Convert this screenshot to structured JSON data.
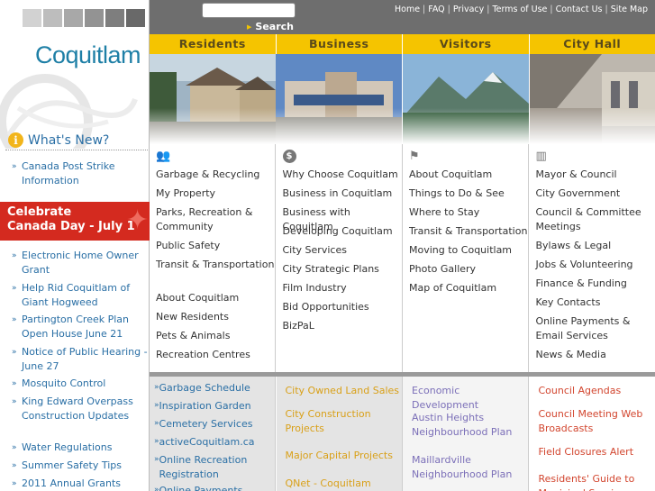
{
  "brand": {
    "logo_text": "Coquitlam",
    "swatches": [
      "#d2d2d2",
      "#bdbdbd",
      "#a8a8a8",
      "#939393",
      "#7e7e7e",
      "#696969"
    ]
  },
  "search": {
    "placeholder": "",
    "button_label": "Search"
  },
  "toplinks": [
    "Home",
    "FAQ",
    "Privacy",
    "Terms of Use",
    "Contact Us",
    "Site Map"
  ],
  "tabs": [
    "Residents",
    "Business",
    "Visitors",
    "City Hall"
  ],
  "whats_new": {
    "label": "What's New?"
  },
  "sidebar_top_links": [
    {
      "label": "Canada Post Strike Information"
    }
  ],
  "banner": {
    "line1": "Celebrate",
    "line2": "Canada Day - July 1"
  },
  "sidebar_links": [
    {
      "label": "Electronic Home Owner Grant"
    },
    {
      "label": "Help Rid Coquitlam of Giant Hogweed"
    },
    {
      "label": "Partington Creek Plan Open House June 21"
    },
    {
      "label": "Notice of Public Hearing - June 27"
    },
    {
      "label": "Mosquito Control"
    },
    {
      "label": "King Edward Overpass Construction Updates"
    },
    {
      "label": "Water Regulations"
    },
    {
      "label": "Summer Safety Tips"
    },
    {
      "label": "2011 Annual Grants"
    }
  ],
  "columns": [
    {
      "icon": "people-icon",
      "items": [
        "Garbage & Recycling",
        "My Property",
        "Parks, Recreation & Community",
        "Public Safety",
        "Transit & Transportation",
        "About Coquitlam",
        "New Residents",
        "Pets & Animals",
        "Recreation Centres"
      ]
    },
    {
      "icon": "dollar-icon",
      "items": [
        "Why Choose Coquitlam",
        "Business in Coquitlam",
        "Business with Coquitlam",
        "Developing Coquitlam",
        "City Services",
        "City Strategic Plans",
        "Film Industry",
        "Bid Opportunities",
        "BizPaL"
      ]
    },
    {
      "icon": "visitor-icon",
      "items": [
        "About Coquitlam",
        "Things to Do & See",
        "Where to Stay",
        "Transit & Transportation",
        "Moving to Coquitlam",
        "Photo Gallery",
        "Map of Coquitlam"
      ]
    },
    {
      "icon": "cityhall-icon",
      "items": [
        "Mayor & Council",
        "City Government",
        "Council & Committee Meetings",
        "Bylaws & Legal",
        "Jobs & Volunteering",
        "Finance & Funding",
        "Key Contacts",
        "Online Payments & Email Services",
        "News & Media"
      ]
    }
  ],
  "bottom": [
    {
      "color": "#2a6fa5",
      "bg": "#e4e4e4",
      "items": [
        "Garbage Schedule",
        "Inspiration Garden",
        "Cemetery Services",
        "activeCoquitlam.ca",
        "Online Recreation Registration",
        "Online Payments"
      ]
    },
    {
      "color": "#d9a018",
      "bg": "#e4e4e4",
      "items": [
        "City Owned Land Sales",
        "City Construction Projects",
        "Major Capital Projects",
        "QNet - Coquitlam Optical"
      ]
    },
    {
      "color": "#7b6fb8",
      "bg": "#f4f4f4",
      "items": [
        "Economic Development",
        "Austin Heights Neighbourhood Plan",
        "Maillardville Neighbourhood Plan"
      ]
    },
    {
      "color": "#d2452e",
      "bg": "#fff",
      "items": [
        "Council Agendas",
        "Council Meeting Web Broadcasts",
        "Field Closures Alert",
        "Residents' Guide to Municipal Services"
      ]
    }
  ]
}
